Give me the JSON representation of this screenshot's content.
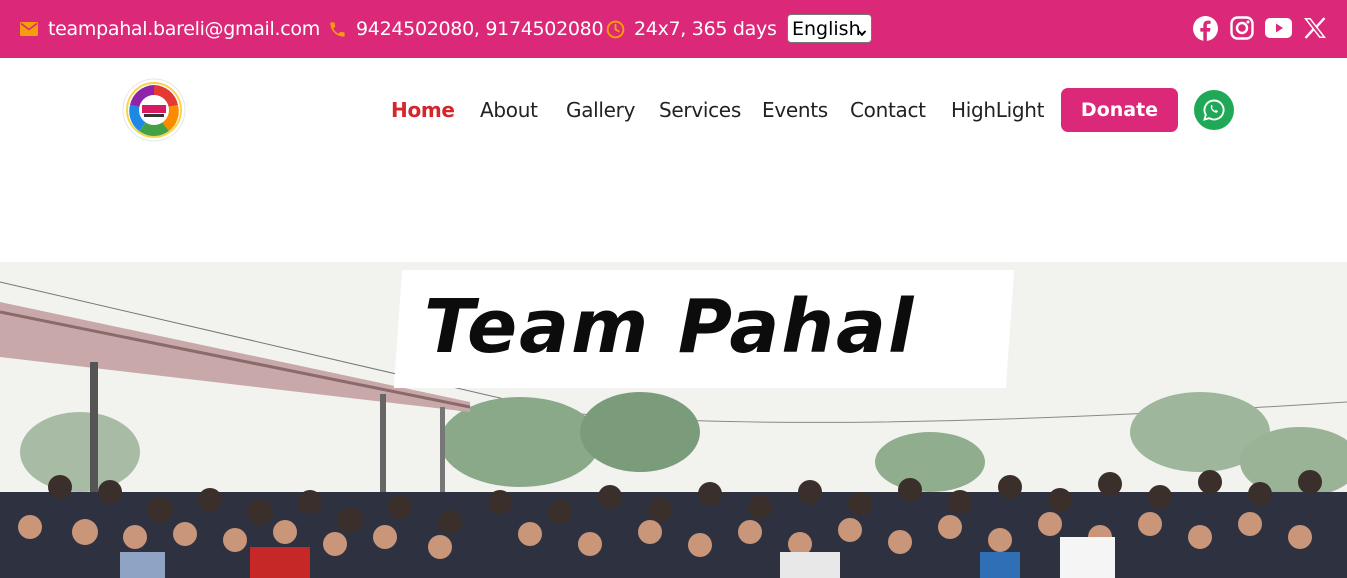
{
  "topbar": {
    "email": "teampahal.bareli@gmail.com",
    "phone": "9424502080, 9174502080",
    "hours": "24x7, 365 days",
    "language": "English",
    "icons": {
      "email": "envelope-icon",
      "phone": "phone-icon",
      "hours": "clock-icon"
    },
    "social": [
      "facebook-icon",
      "instagram-icon",
      "youtube-icon",
      "x-icon"
    ]
  },
  "nav": {
    "items": [
      {
        "label": "Home",
        "active": true
      },
      {
        "label": "About"
      },
      {
        "label": "Gallery"
      },
      {
        "label": "Services"
      },
      {
        "label": "Events"
      },
      {
        "label": "Contact"
      },
      {
        "label": "HighLight"
      }
    ],
    "donate_label": "Donate",
    "whatsapp_icon": "whatsapp-icon"
  },
  "hero": {
    "banner_text": "Team Pahal"
  },
  "colors": {
    "brand_pink": "#dc2878",
    "active_link": "#d4262b",
    "icon_orange": "#f59e0b",
    "whatsapp_green": "#1fa855"
  }
}
